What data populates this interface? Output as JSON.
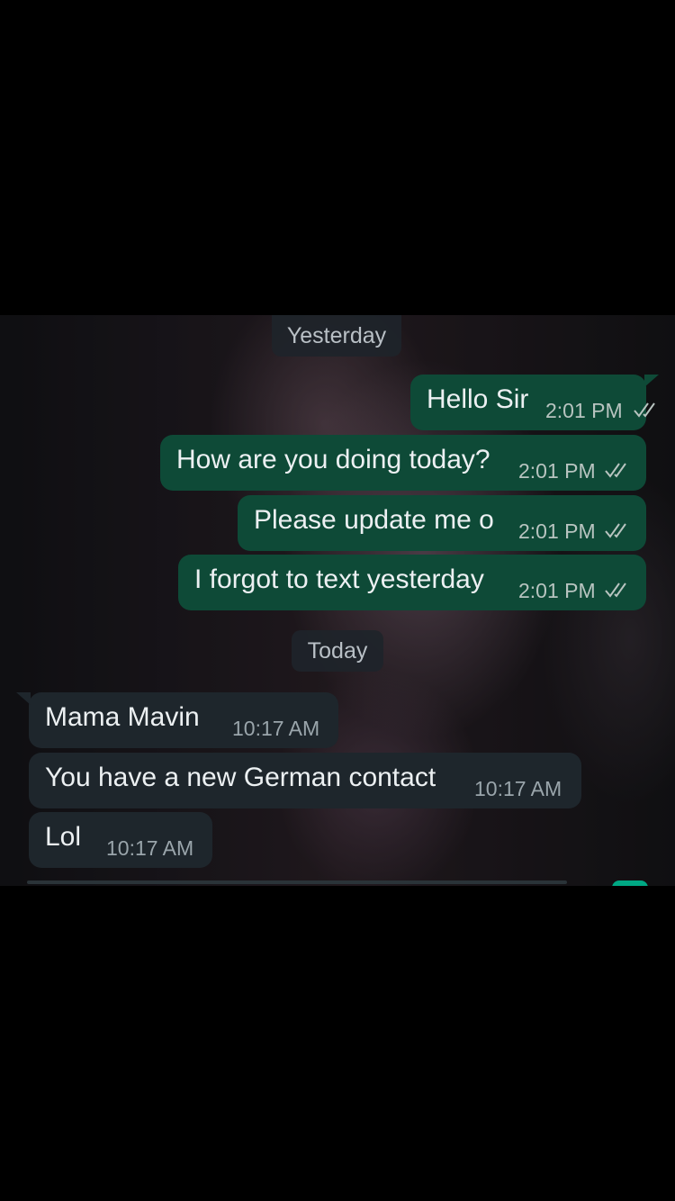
{
  "chat": {
    "date_yesterday": "Yesterday",
    "date_today": "Today",
    "outgoing": [
      {
        "text": "Hello Sir",
        "time": "2:01 PM",
        "status": "read"
      },
      {
        "text": "How are you doing today?",
        "time": "2:01 PM",
        "status": "read"
      },
      {
        "text": "Please update me o",
        "time": "2:01 PM",
        "status": "read"
      },
      {
        "text": "I forgot to text yesterday",
        "time": "2:01 PM",
        "status": "read"
      }
    ],
    "incoming": [
      {
        "text": "Mama Mavin",
        "time": "10:17 AM"
      },
      {
        "text": "You have a new German contact",
        "time": "10:17 AM"
      },
      {
        "text": "Lol",
        "time": "10:17 AM"
      }
    ]
  },
  "icons": {
    "read_receipt": "double-check-icon"
  },
  "colors": {
    "outgoing_bubble": "#0e4a37",
    "incoming_bubble": "#1e262c",
    "date_chip": "#1e242a",
    "accent": "#00a884",
    "read_checks": "#b8c4c0"
  }
}
